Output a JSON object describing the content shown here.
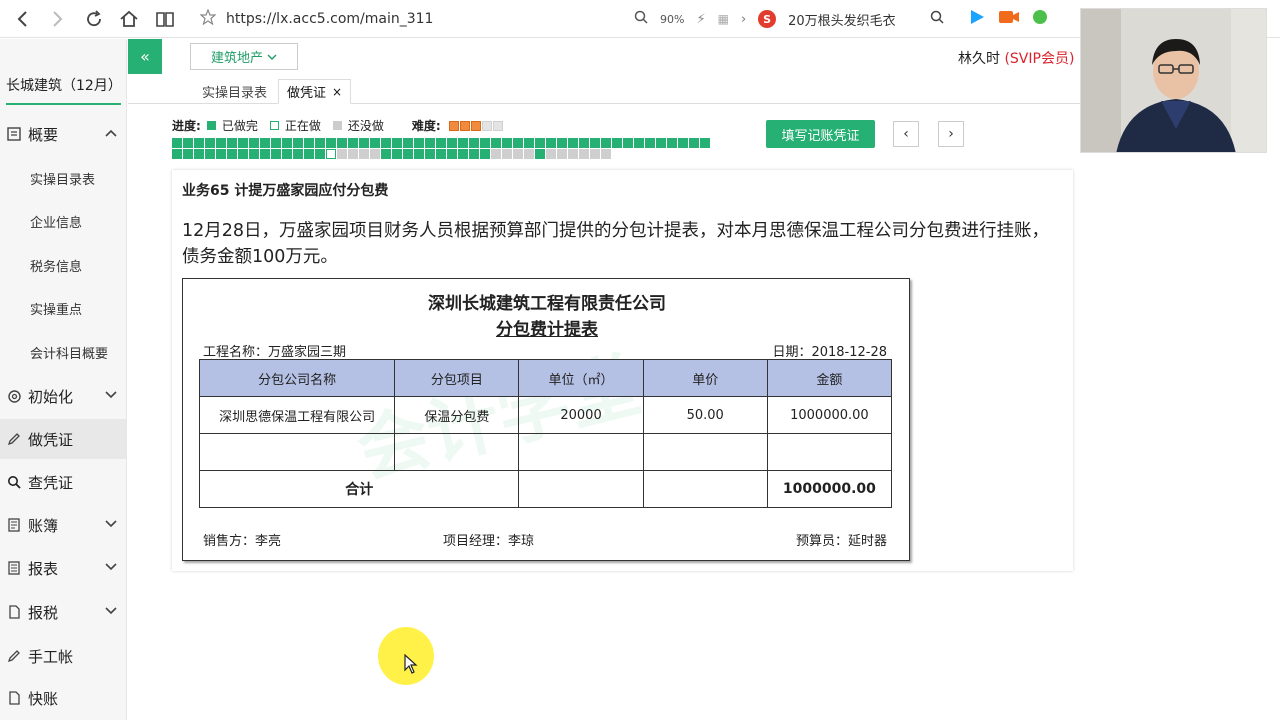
{
  "browser": {
    "url": "https://lx.acc5.com/main_311",
    "zoom": "90%",
    "search_hint": "20万根头发织毛衣"
  },
  "sidebar": {
    "company": "长城建筑（12月）",
    "items": [
      {
        "label": "概要",
        "icon": "grid-icon",
        "expanded": true
      },
      {
        "label": "实操目录表"
      },
      {
        "label": "企业信息"
      },
      {
        "label": "税务信息"
      },
      {
        "label": "实操重点"
      },
      {
        "label": "会计科目概要"
      },
      {
        "label": "初始化",
        "icon": "gear-icon"
      },
      {
        "label": "做凭证",
        "icon": "pen-icon",
        "active": true
      },
      {
        "label": "查凭证",
        "icon": "search-icon"
      },
      {
        "label": "账簿",
        "icon": "ledger-icon"
      },
      {
        "label": "报表",
        "icon": "report-icon"
      },
      {
        "label": "报税",
        "icon": "file-icon"
      },
      {
        "label": "手工帐",
        "icon": "pen-icon"
      },
      {
        "label": "快账",
        "icon": "file-icon"
      }
    ]
  },
  "header": {
    "industry": "建筑地产",
    "user_name": "林久时",
    "vip": "(SVIP会员)"
  },
  "tabs": [
    {
      "label": "实操目录表"
    },
    {
      "label": "做凭证",
      "active": true
    }
  ],
  "progress": {
    "label": "进度:",
    "done": "已做完",
    "doing": "正在做",
    "todo": "还没做",
    "difficulty_label": "难度:",
    "difficulty": 3,
    "difficulty_max": 5
  },
  "toolbar": {
    "fill_voucher": "填写记账凭证",
    "prev": "‹",
    "next": "›"
  },
  "task": {
    "title": "业务65 计提万盛家园应付分包费",
    "description": "12月28日，万盛家园项目财务人员根据预算部门提供的分包计提表，对本月思德保温工程公司分包费进行挂账，债务金额100万元。"
  },
  "document": {
    "company": "深圳长城建筑工程有限责任公司",
    "title": "分包费计提表",
    "project": "工程名称：万盛家园三期",
    "date": "日期：2018-12-28",
    "headers": [
      "分包公司名称",
      "分包项目",
      "单位（㎡）",
      "单价",
      "金额"
    ],
    "rows": [
      [
        "深圳思德保温工程有限公司",
        "保温分包费",
        "20000",
        "50.00",
        "1000000.00"
      ],
      [
        "",
        "",
        "",
        "",
        ""
      ]
    ],
    "total_label": "合计",
    "total_amount": "1000000.00",
    "seller": "销售方：李亮",
    "manager": "项目经理：李琼",
    "budgeter": "预算员：延时器",
    "watermark": "会计学堂"
  },
  "colors": {
    "accent": "#26b074",
    "header_fill": "#b4c0e4",
    "vip": "#d9232d"
  }
}
